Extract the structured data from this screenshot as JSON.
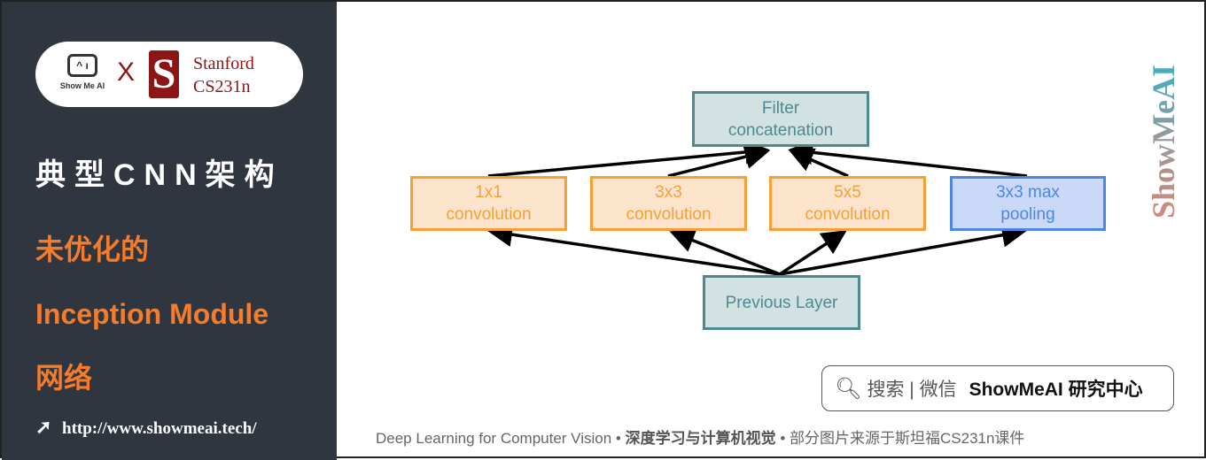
{
  "sidebar": {
    "logo": {
      "showme": "Show Me AI",
      "x": "X",
      "stanford_s": "S",
      "stanford": "Stanford",
      "course": "CS231n"
    },
    "title": "典型CNN架构",
    "sub1": "未优化的",
    "sub2": "Inception Module",
    "sub3": "网络",
    "url": "http://www.showmeai.tech/",
    "url_icon": "cursor-click-icon"
  },
  "diagram": {
    "top": [
      "Filter",
      "concatenation"
    ],
    "branches": [
      [
        "1x1",
        "convolution"
      ],
      [
        "3x3",
        "convolution"
      ],
      [
        "5x5",
        "convolution"
      ],
      [
        "3x3 max",
        "pooling"
      ]
    ],
    "bottom": "Previous Layer",
    "colors": {
      "teal": "#4d8a8f",
      "orange": "#f7a035",
      "blue": "#4f86e3"
    }
  },
  "watermark": "ShowMeAI",
  "search": {
    "icon": "search-icon",
    "label": "搜索 | 微信",
    "brand": "ShowMeAI 研究中心"
  },
  "footer": {
    "en": "Deep Learning for Computer Vision",
    "sep": " • ",
    "cn": "深度学习与计算机视觉",
    "note": "部分图片来源于斯坦福CS231n课件"
  }
}
